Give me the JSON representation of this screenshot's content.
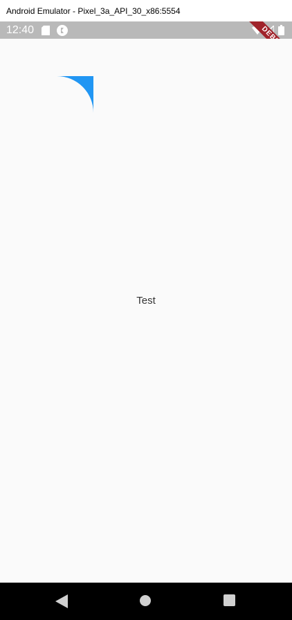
{
  "window": {
    "title": "Android Emulator - Pixel_3a_API_30_x86:5554"
  },
  "status_bar": {
    "time": "12:40",
    "icons": [
      "sd-card-icon",
      "flutter-icon",
      "wifi-icon",
      "signal-icon",
      "battery-icon"
    ]
  },
  "debug_banner": {
    "label": "DEBUG"
  },
  "content": {
    "text": "Test",
    "shape_color": "#2196f3"
  },
  "nav_bar": {
    "icons": [
      "back-icon",
      "home-icon",
      "recents-icon"
    ]
  }
}
